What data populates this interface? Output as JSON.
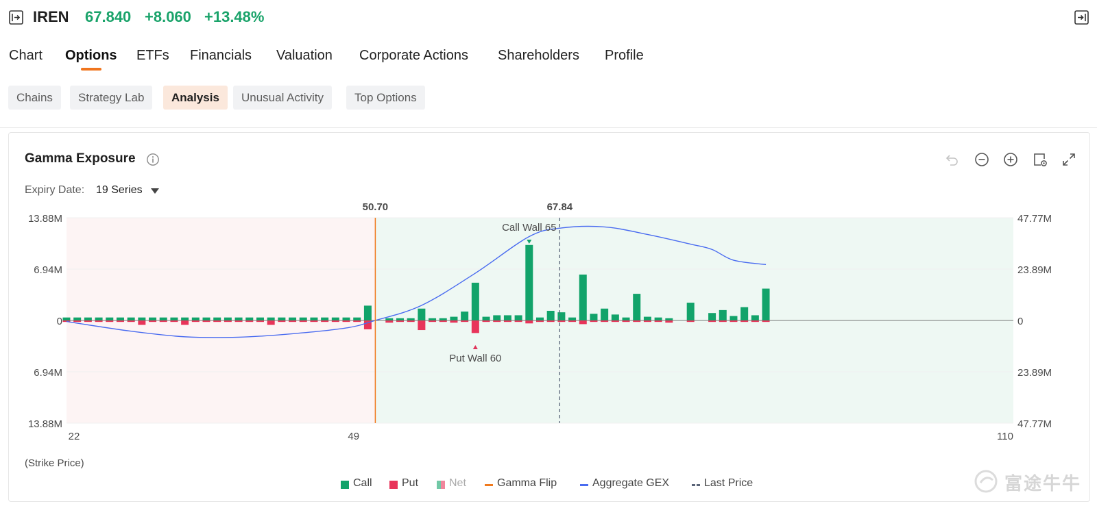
{
  "header": {
    "ticker": "IREN",
    "price": "67.840",
    "change": "+8.060",
    "change_pct": "+13.48%",
    "up_color": "#1aa36a"
  },
  "main_tabs": [
    {
      "label": "Chart",
      "active": false
    },
    {
      "label": "Options",
      "active": true
    },
    {
      "label": "ETFs",
      "active": false
    },
    {
      "label": "Financials",
      "active": false
    },
    {
      "label": "Valuation",
      "active": false
    },
    {
      "label": "Corporate Actions",
      "active": false
    },
    {
      "label": "Shareholders",
      "active": false
    },
    {
      "label": "Profile",
      "active": false
    }
  ],
  "sub_tabs": [
    {
      "label": "Chains",
      "active": false
    },
    {
      "label": "Strategy Lab",
      "active": false
    },
    {
      "label": "Analysis",
      "active": true
    },
    {
      "label": "Unusual Activity",
      "active": false
    },
    {
      "label": "Top Options",
      "active": false
    }
  ],
  "card": {
    "title": "Gamma Exposure",
    "expiry_label": "Expiry Date:",
    "expiry_value": "19 Series",
    "tools": [
      "undo-icon",
      "zoom-out-icon",
      "zoom-in-icon",
      "snapshot-settings-icon",
      "fullscreen-icon"
    ]
  },
  "chart_data": {
    "type": "bar",
    "x_label": "(Strike Price)",
    "x_ticks": [
      "22",
      "49",
      "110"
    ],
    "x_range": [
      22,
      110
    ],
    "left_axis": {
      "ticks": [
        "13.88M",
        "6.94M",
        "0",
        "6.94M",
        "13.88M"
      ],
      "range": [
        -13.88,
        13.88
      ],
      "unit": "M"
    },
    "right_axis": {
      "ticks": [
        "47.77M",
        "23.89M",
        "0",
        "23.89M",
        "47.77M"
      ],
      "range": [
        -47.77,
        47.77
      ],
      "unit": "M"
    },
    "gamma_flip": {
      "value": 50.7,
      "label": "50.70",
      "color": "#f07a1e"
    },
    "last_price": {
      "value": 67.84,
      "label": "67.84",
      "color": "#5a6478"
    },
    "call_wall": {
      "label": "Call Wall 65",
      "strike": 65,
      "color": "#12a36a"
    },
    "put_wall": {
      "label": "Put Wall 60",
      "strike": 60,
      "color": "#e0345a"
    },
    "colors": {
      "call": "#12a36a",
      "put": "#e8345a",
      "aggregate": "#4a6cf0",
      "neg_zone": "#fdf4f4",
      "pos_zone": "#eef8f3"
    },
    "series": [
      {
        "name": "Call",
        "points": [
          [
            22,
            0.4
          ],
          [
            23,
            0.4
          ],
          [
            24,
            0.4
          ],
          [
            25,
            0.4
          ],
          [
            26,
            0.4
          ],
          [
            27,
            0.4
          ],
          [
            28,
            0.4
          ],
          [
            29,
            0.4
          ],
          [
            30,
            0.4
          ],
          [
            31,
            0.4
          ],
          [
            32,
            0.4
          ],
          [
            33,
            0.4
          ],
          [
            34,
            0.4
          ],
          [
            35,
            0.4
          ],
          [
            36,
            0.4
          ],
          [
            37,
            0.4
          ],
          [
            38,
            0.4
          ],
          [
            39,
            0.4
          ],
          [
            40,
            0.4
          ],
          [
            41,
            0.4
          ],
          [
            42,
            0.4
          ],
          [
            43,
            0.4
          ],
          [
            44,
            0.4
          ],
          [
            45,
            0.4
          ],
          [
            46,
            0.4
          ],
          [
            47,
            0.4
          ],
          [
            48,
            0.4
          ],
          [
            49,
            0.4
          ],
          [
            50,
            2.0
          ],
          [
            52,
            0.3
          ],
          [
            53,
            0.3
          ],
          [
            54,
            0.3
          ],
          [
            55,
            1.6
          ],
          [
            56,
            0.3
          ],
          [
            57,
            0.3
          ],
          [
            58,
            0.5
          ],
          [
            59,
            1.2
          ],
          [
            60,
            5.1
          ],
          [
            61,
            0.5
          ],
          [
            62,
            0.7
          ],
          [
            63,
            0.7
          ],
          [
            64,
            0.7
          ],
          [
            65,
            10.2
          ],
          [
            66,
            0.4
          ],
          [
            67,
            1.3
          ],
          [
            68,
            1.1
          ],
          [
            69,
            0.4
          ],
          [
            70,
            6.2
          ],
          [
            71,
            0.9
          ],
          [
            72,
            1.6
          ],
          [
            73,
            0.8
          ],
          [
            74,
            0.4
          ],
          [
            75,
            3.6
          ],
          [
            76,
            0.5
          ],
          [
            77,
            0.4
          ],
          [
            78,
            0.3
          ],
          [
            80,
            2.4
          ],
          [
            82,
            1.0
          ],
          [
            83,
            1.4
          ],
          [
            84,
            0.6
          ],
          [
            85,
            1.8
          ],
          [
            86,
            0.7
          ],
          [
            87,
            4.3
          ]
        ]
      },
      {
        "name": "Put",
        "points": [
          [
            22,
            -0.2
          ],
          [
            23,
            -0.2
          ],
          [
            24,
            -0.2
          ],
          [
            25,
            -0.2
          ],
          [
            26,
            -0.2
          ],
          [
            27,
            -0.2
          ],
          [
            28,
            -0.2
          ],
          [
            29,
            -0.6
          ],
          [
            30,
            -0.2
          ],
          [
            31,
            -0.2
          ],
          [
            32,
            -0.2
          ],
          [
            33,
            -0.6
          ],
          [
            34,
            -0.2
          ],
          [
            35,
            -0.2
          ],
          [
            36,
            -0.2
          ],
          [
            37,
            -0.2
          ],
          [
            38,
            -0.2
          ],
          [
            39,
            -0.2
          ],
          [
            40,
            -0.2
          ],
          [
            41,
            -0.6
          ],
          [
            42,
            -0.2
          ],
          [
            43,
            -0.2
          ],
          [
            44,
            -0.2
          ],
          [
            45,
            -0.2
          ],
          [
            46,
            -0.2
          ],
          [
            47,
            -0.2
          ],
          [
            48,
            -0.2
          ],
          [
            49,
            -0.2
          ],
          [
            50,
            -1.2
          ],
          [
            52,
            -0.3
          ],
          [
            53,
            -0.2
          ],
          [
            54,
            -0.2
          ],
          [
            55,
            -1.3
          ],
          [
            56,
            -0.2
          ],
          [
            57,
            -0.2
          ],
          [
            58,
            -0.3
          ],
          [
            59,
            -0.2
          ],
          [
            60,
            -1.7
          ],
          [
            61,
            -0.2
          ],
          [
            62,
            -0.2
          ],
          [
            63,
            -0.2
          ],
          [
            64,
            -0.2
          ],
          [
            65,
            -0.4
          ],
          [
            66,
            -0.2
          ],
          [
            67,
            -0.2
          ],
          [
            68,
            -0.2
          ],
          [
            69,
            -0.2
          ],
          [
            70,
            -0.5
          ],
          [
            71,
            -0.2
          ],
          [
            72,
            -0.2
          ],
          [
            73,
            -0.2
          ],
          [
            74,
            -0.2
          ],
          [
            75,
            -0.2
          ],
          [
            76,
            -0.2
          ],
          [
            77,
            -0.2
          ],
          [
            78,
            -0.3
          ],
          [
            80,
            -0.2
          ],
          [
            82,
            -0.2
          ],
          [
            83,
            -0.2
          ],
          [
            84,
            -0.2
          ],
          [
            85,
            -0.2
          ],
          [
            86,
            -0.2
          ],
          [
            87,
            -0.2
          ]
        ]
      },
      {
        "name": "Aggregate GEX",
        "axis": "right",
        "points": [
          [
            22,
            -0.5
          ],
          [
            28,
            -5
          ],
          [
            33,
            -7.6
          ],
          [
            38,
            -7.8
          ],
          [
            43,
            -6.2
          ],
          [
            48,
            -3.5
          ],
          [
            50.7,
            0
          ],
          [
            55,
            7
          ],
          [
            60,
            22
          ],
          [
            65,
            39
          ],
          [
            68,
            43
          ],
          [
            72,
            43.5
          ],
          [
            76,
            40
          ],
          [
            80,
            35.5
          ],
          [
            82,
            33
          ],
          [
            84,
            28
          ],
          [
            87,
            26
          ]
        ]
      }
    ],
    "legend": [
      {
        "label": "Call",
        "icon": "square",
        "color": "#12a36a"
      },
      {
        "label": "Put",
        "icon": "square",
        "color": "#e8345a"
      },
      {
        "label": "Net",
        "icon": "split-square",
        "color": "#9a9a9a",
        "disabled": true
      },
      {
        "label": "Gamma Flip",
        "icon": "line",
        "color": "#f07a1e"
      },
      {
        "label": "Aggregate GEX",
        "icon": "line",
        "color": "#4a6cf0"
      },
      {
        "label": "Last Price",
        "icon": "dashed-line",
        "color": "#5a6478"
      }
    ]
  },
  "watermark": "富途牛牛"
}
